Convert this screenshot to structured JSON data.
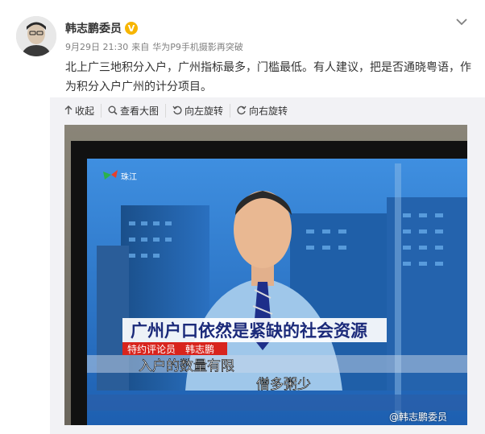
{
  "post": {
    "author": "韩志鹏委员",
    "verified_badge": "V",
    "date": "9月29日 21:30",
    "source_prefix": "来自",
    "source": "华为P9手机摄影再突破",
    "text": "北上广三地积分入户，广州指标最多，门槛最低。有人建议，把是否通晓粤语，作为积分入户广州的计分项目。"
  },
  "toolbar": {
    "collapse": "收起",
    "view_large": "查看大图",
    "rotate_left": "向左旋转",
    "rotate_right": "向右旋转"
  },
  "photo": {
    "headline": "广州户口依然是紧缺的社会资源",
    "role_tag": "特约评论员",
    "commentator": "韩志鹏",
    "subtitle_left": "入户的数量有限",
    "subtitle_right": "僧多粥少",
    "channel_logo_text": "珠江"
  },
  "watermark": "@韩志鹏委员"
}
